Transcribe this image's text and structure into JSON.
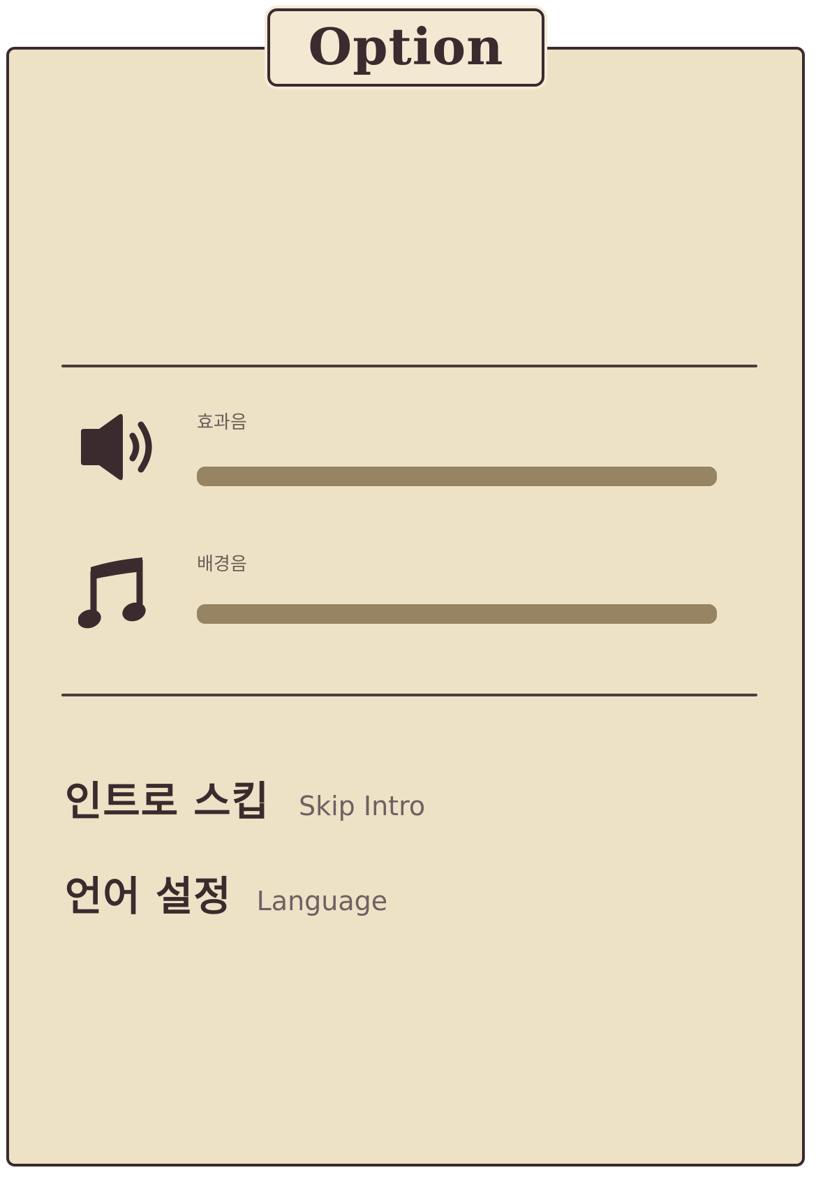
{
  "title": "Option",
  "sound": {
    "sfx": {
      "label": "효과음",
      "icon": "speaker-icon",
      "level": 1.0
    },
    "bgm": {
      "label": "배경음",
      "icon": "music-note-icon",
      "level": 1.0
    }
  },
  "menu": {
    "skip_intro": {
      "label": "인트로 스킵",
      "sublabel": "Skip Intro"
    },
    "language": {
      "label": "언어 설정",
      "sublabel": "Language"
    }
  },
  "colors": {
    "panel_bg": "#eee2c6",
    "ink": "#3b2a2e",
    "slider": "#968463",
    "muted_text": "#6e6062"
  }
}
